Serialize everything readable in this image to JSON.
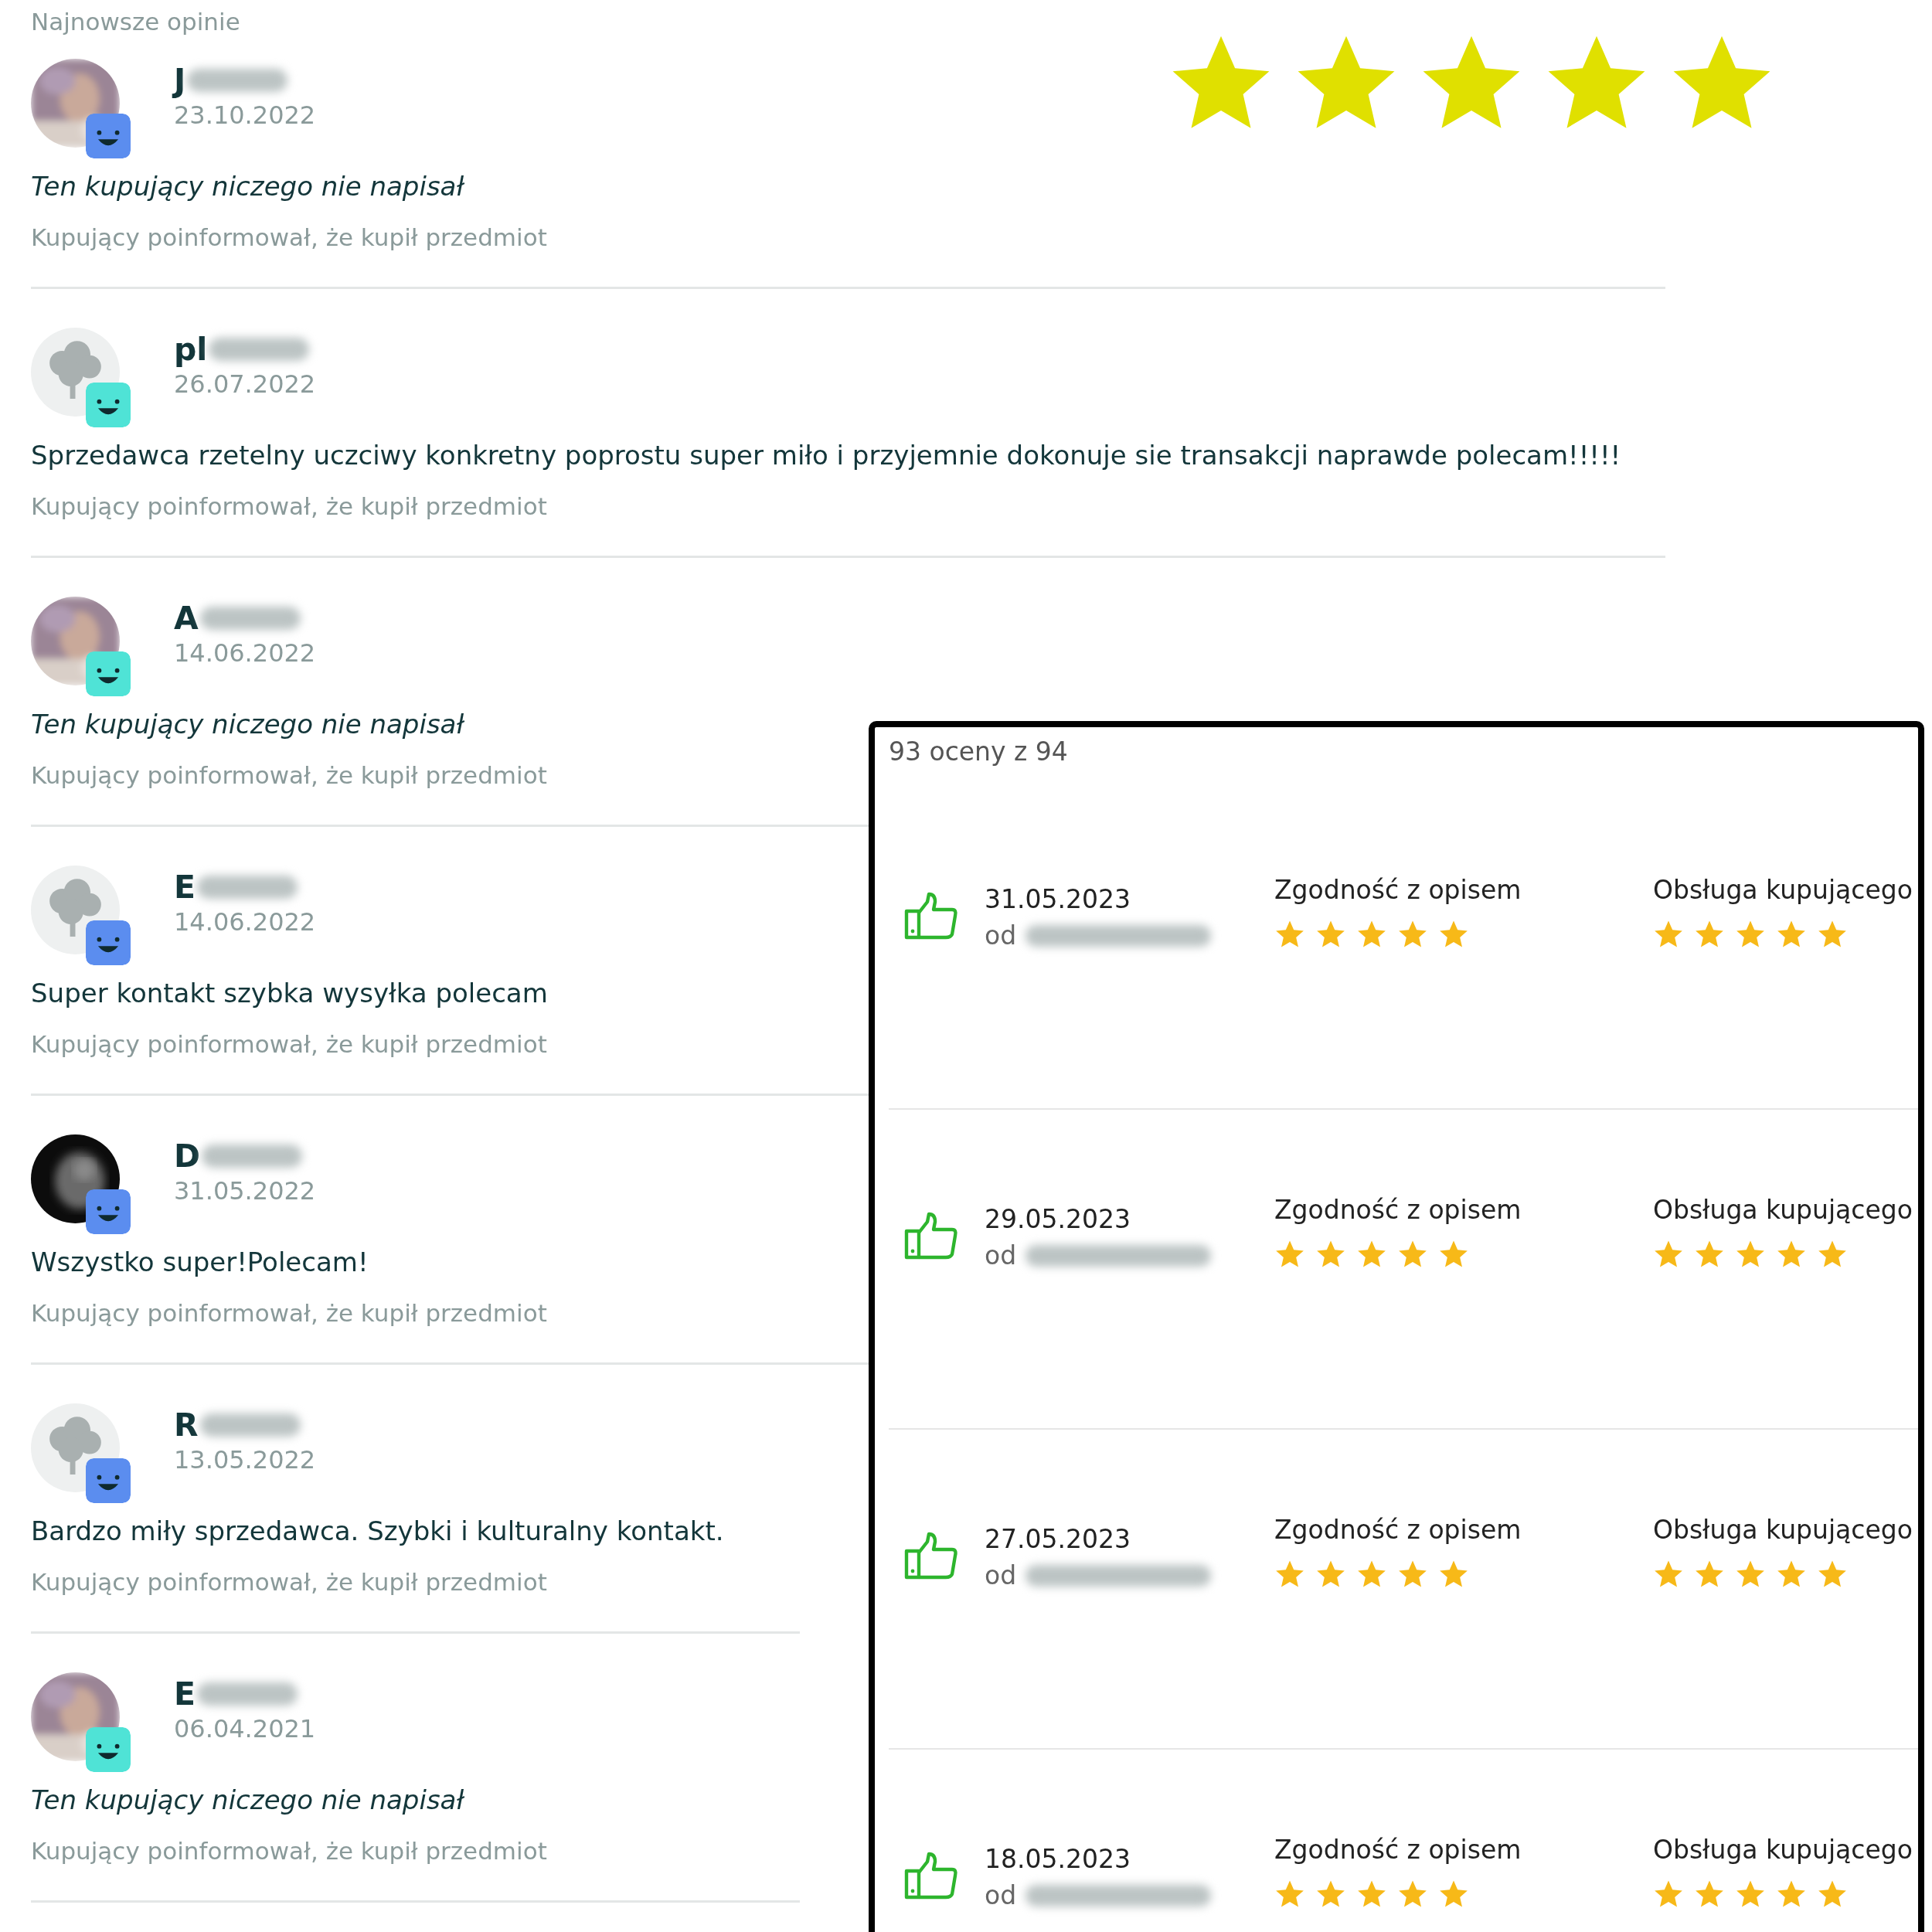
{
  "heading": "Najnowsze opinie",
  "top_rating": {
    "stars": 5
  },
  "reviews": [
    {
      "name": "J",
      "date": "23.10.2022",
      "comment": "Ten kupujący niczego nie napisał",
      "kind": "empty",
      "note": "Kupujący poinformował, że kupił przedmiot",
      "badge": {
        "color": "#5b8def"
      }
    },
    {
      "name": "pl",
      "date": "26.07.2022",
      "comment": "Sprzedawca rzetelny uczciwy konkretny poprostu super miło i przyjemnie dokonuje sie transakcji naprawde polecam!!!!!",
      "kind": "text",
      "note": "Kupujący poinformował, że kupił przedmiot",
      "avatar": {
        "kind": "default"
      },
      "badge": {
        "color": "#4fe3d6"
      }
    },
    {
      "name": "A",
      "date": "14.06.2022",
      "comment": "Ten kupujący niczego nie napisał",
      "kind": "empty",
      "note": "Kupujący poinformował, że kupił przedmiot",
      "badge": {
        "color": "#4fe3d6"
      }
    },
    {
      "name": "E",
      "date": "14.06.2022",
      "comment": "Super kontakt szybka wysyłka polecam",
      "kind": "text",
      "note": "Kupujący poinformował, że kupił przedmiot",
      "avatar": {
        "kind": "default"
      },
      "badge": {
        "color": "#5b8def"
      }
    },
    {
      "name": "D",
      "date": "31.05.2022",
      "comment": "Wszystko super!Polecam!",
      "kind": "text",
      "note": "Kupujący poinformował, że kupił przedmiot",
      "avatar": {
        "kind": "dark"
      },
      "badge": {
        "color": "#5b8def"
      }
    },
    {
      "name": "R",
      "date": "13.05.2022",
      "comment": "Bardzo miły sprzedawca. Szybki i kulturalny kontakt.",
      "kind": "text",
      "note": "Kupujący poinformował, że kupił przedmiot",
      "avatar": {
        "kind": "default"
      },
      "badge": {
        "color": "#5b8def"
      }
    },
    {
      "name": "E",
      "date": "06.04.2021",
      "comment": "Ten kupujący niczego nie napisał",
      "kind": "empty",
      "note": "Kupujący poinformował, że kupił przedmiot",
      "badge": {
        "color": "#4fe3d6"
      }
    }
  ],
  "ratings_panel": {
    "count": "93 oceny z 94",
    "rows": [
      {
        "date": "31.05.2023",
        "from": "od",
        "ratings": [
          {
            "label": "Zgodność z opisem",
            "stars": 5
          },
          {
            "label": "Obsługa kupującego",
            "stars": 5
          }
        ]
      },
      {
        "date": "29.05.2023",
        "from": "od",
        "ratings": [
          {
            "label": "Zgodność z opisem",
            "stars": 5
          },
          {
            "label": "Obsługa kupującego",
            "stars": 5
          }
        ]
      },
      {
        "date": "27.05.2023",
        "from": "od",
        "ratings": [
          {
            "label": "Zgodność z opisem",
            "stars": 5
          },
          {
            "label": "Obsługa kupującego",
            "stars": 5
          }
        ]
      },
      {
        "date": "18.05.2023",
        "from": "od",
        "ratings": [
          {
            "label": "Zgodność z opisem",
            "stars": 5
          },
          {
            "label": "Obsługa kupującego",
            "stars": 5
          }
        ]
      }
    ]
  }
}
